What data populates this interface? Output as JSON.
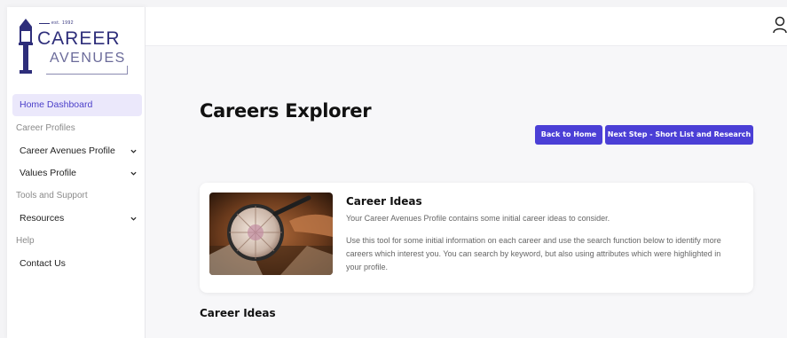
{
  "logo": {
    "est": "est. 1992",
    "word1": "CAREER",
    "word2": "AVENUES"
  },
  "sidebar": {
    "items": [
      {
        "type": "item",
        "label": "Home Dashboard",
        "active": true
      },
      {
        "type": "heading",
        "label": "Career Profiles"
      },
      {
        "type": "item",
        "label": "Career Avenues Profile",
        "chevron": true
      },
      {
        "type": "item",
        "label": "Values Profile",
        "chevron": true
      },
      {
        "type": "heading",
        "label": "Tools and Support"
      },
      {
        "type": "item",
        "label": "Resources",
        "chevron": true
      },
      {
        "type": "heading",
        "label": "Help"
      },
      {
        "type": "item",
        "label": "Contact Us"
      }
    ]
  },
  "header": {
    "user_icon": "user-icon"
  },
  "main": {
    "title": "Careers Explorer",
    "buttons": {
      "back_home": "Back to Home",
      "next_step": "Next Step - Short List and Research"
    },
    "card": {
      "title": "Career Ideas",
      "p1": "Your Career Avenues Profile contains some initial career ideas to consider.",
      "p2": "Use this tool for some initial information on each career and use the search function below to identify more careers which interest you. You can search by keyword, but also using attributes which were highlighted in your profile.",
      "image_icon": "magnifying-glass-image"
    },
    "section_title": "Career Ideas"
  },
  "colors": {
    "accent": "#4b3fd6",
    "active_bg": "#ebe8fb",
    "brand": "#2e2e7a"
  }
}
